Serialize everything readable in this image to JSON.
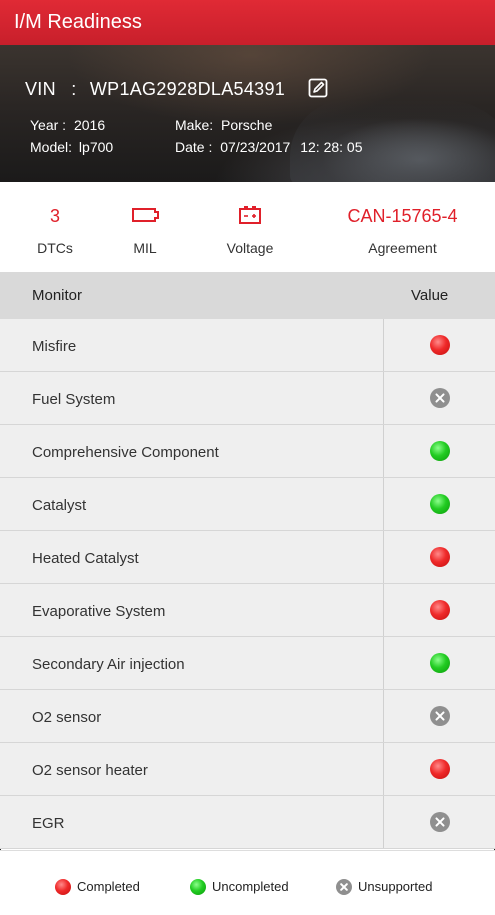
{
  "header": {
    "title": "I/M Readiness"
  },
  "vehicle": {
    "vin_label": "VIN",
    "vin_sep": ":",
    "vin": "WP1AG2928DLA54391",
    "year_label": "Year :",
    "year": "2016",
    "model_label": "Model:",
    "model": "lp700",
    "make_label": "Make:",
    "make": "Porsche",
    "date_label": "Date :",
    "date": "07/23/2017",
    "time": "12: 28: 05"
  },
  "stats": {
    "dtcs": {
      "value": "3",
      "label": "DTCs"
    },
    "mil": {
      "label": "MIL",
      "icon": "engine-icon"
    },
    "voltage": {
      "label": "Voltage",
      "icon": "battery-icon"
    },
    "agreement": {
      "value": "CAN-15765-4",
      "label": "Agreement"
    }
  },
  "table": {
    "col_monitor": "Monitor",
    "col_value": "Value",
    "rows": [
      {
        "name": "Misfire",
        "status": "completed"
      },
      {
        "name": "Fuel System",
        "status": "unsupported"
      },
      {
        "name": "Comprehensive Component",
        "status": "uncompleted"
      },
      {
        "name": "Catalyst",
        "status": "uncompleted"
      },
      {
        "name": "Heated Catalyst",
        "status": "completed"
      },
      {
        "name": "Evaporative System",
        "status": "completed"
      },
      {
        "name": "Secondary Air injection",
        "status": "uncompleted"
      },
      {
        "name": "O2 sensor",
        "status": "unsupported"
      },
      {
        "name": "O2 sensor heater",
        "status": "completed"
      },
      {
        "name": "EGR",
        "status": "unsupported"
      }
    ]
  },
  "legend": {
    "completed": "Completed",
    "uncompleted": "Uncompleted",
    "unsupported": "Unsupported"
  },
  "colors": {
    "accent": "#e0202a",
    "completed": "#ef2a2a",
    "uncompleted": "#22cc22",
    "unsupported": "#8f8f8f"
  }
}
